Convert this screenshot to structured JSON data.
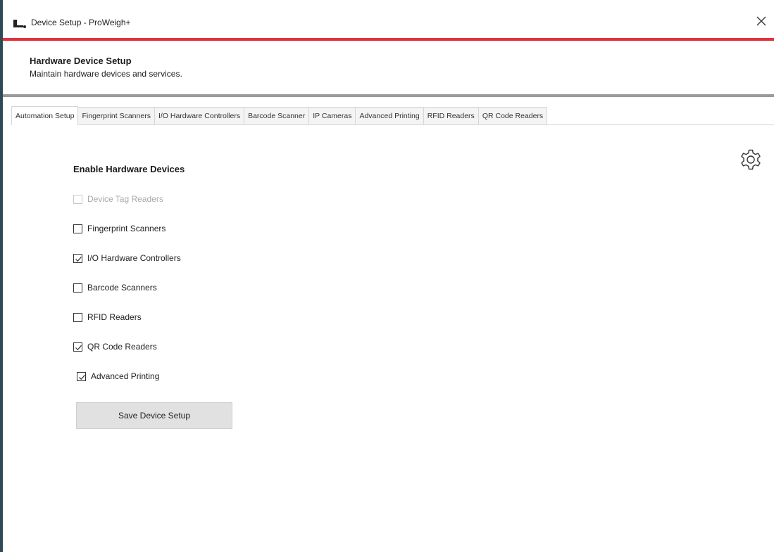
{
  "window": {
    "title": "Device Setup - ProWeigh+"
  },
  "header": {
    "title": "Hardware Device Setup",
    "subtitle": "Maintain hardware devices and services."
  },
  "tabs": [
    {
      "label": "Automation Setup",
      "active": true
    },
    {
      "label": "Fingerprint Scanners",
      "active": false
    },
    {
      "label": "I/O Hardware Controllers",
      "active": false
    },
    {
      "label": "Barcode Scanner",
      "active": false
    },
    {
      "label": "IP Cameras",
      "active": false
    },
    {
      "label": "Advanced Printing",
      "active": false
    },
    {
      "label": "RFID Readers",
      "active": false
    },
    {
      "label": "QR Code Readers",
      "active": false
    }
  ],
  "content": {
    "section_title": "Enable Hardware Devices",
    "checkboxes": [
      {
        "label": "Device Tag Readers",
        "checked": false,
        "disabled": true
      },
      {
        "label": "Fingerprint Scanners",
        "checked": false,
        "disabled": false
      },
      {
        "label": "I/O Hardware Controllers",
        "checked": true,
        "disabled": false
      },
      {
        "label": "Barcode Scanners",
        "checked": false,
        "disabled": false
      },
      {
        "label": "RFID Readers",
        "checked": false,
        "disabled": false
      },
      {
        "label": "QR Code Readers",
        "checked": true,
        "disabled": false
      },
      {
        "label": "Advanced Printing",
        "checked": true,
        "disabled": false
      }
    ],
    "save_button": "Save Device Setup"
  },
  "icons": {
    "app": "scale-icon",
    "close": "close-icon",
    "settings": "gear-icon",
    "check": "checkmark-icon"
  },
  "colors": {
    "accent": "#e0323b",
    "divider": "#9a9a9a",
    "desktop": "#2f4a57",
    "button_bg": "#e1e1e1"
  }
}
